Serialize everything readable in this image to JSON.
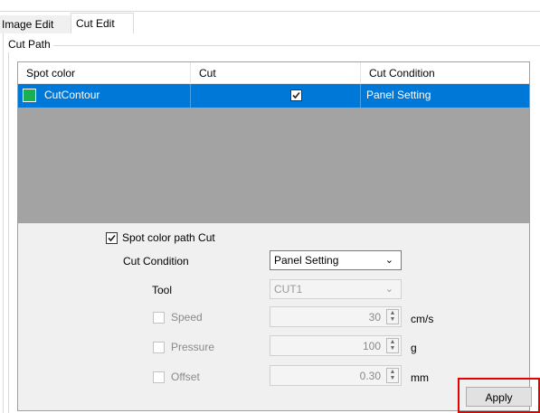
{
  "tabs": [
    {
      "label": "Image Edit",
      "active": false
    },
    {
      "label": "Cut Edit",
      "active": true
    }
  ],
  "group": {
    "label": "Cut Path"
  },
  "grid": {
    "columns": [
      "Spot color",
      "Cut",
      "Cut Condition"
    ],
    "rows": [
      {
        "spot_color": "CutContour",
        "swatch_color": "#18b050",
        "cut_checked": true,
        "cut_condition": "Panel Setting",
        "selected": true
      }
    ]
  },
  "options": {
    "spot_color_path_cut": {
      "label": "Spot color path Cut",
      "checked": true
    },
    "cut_condition": {
      "label": "Cut Condition",
      "value": "Panel Setting"
    },
    "tool": {
      "label": "Tool",
      "value": "CUT1"
    },
    "speed": {
      "label": "Speed",
      "value": "30",
      "unit": "cm/s",
      "checked": false
    },
    "pressure": {
      "label": "Pressure",
      "value": "100",
      "unit": "g",
      "checked": false
    },
    "offset": {
      "label": "Offset",
      "value": "0.30",
      "unit": "mm",
      "checked": false
    }
  },
  "apply": {
    "label": "Apply"
  },
  "colors": {
    "selection": "#0078d7",
    "highlight": "#e60000",
    "swatch": "#18b050"
  }
}
